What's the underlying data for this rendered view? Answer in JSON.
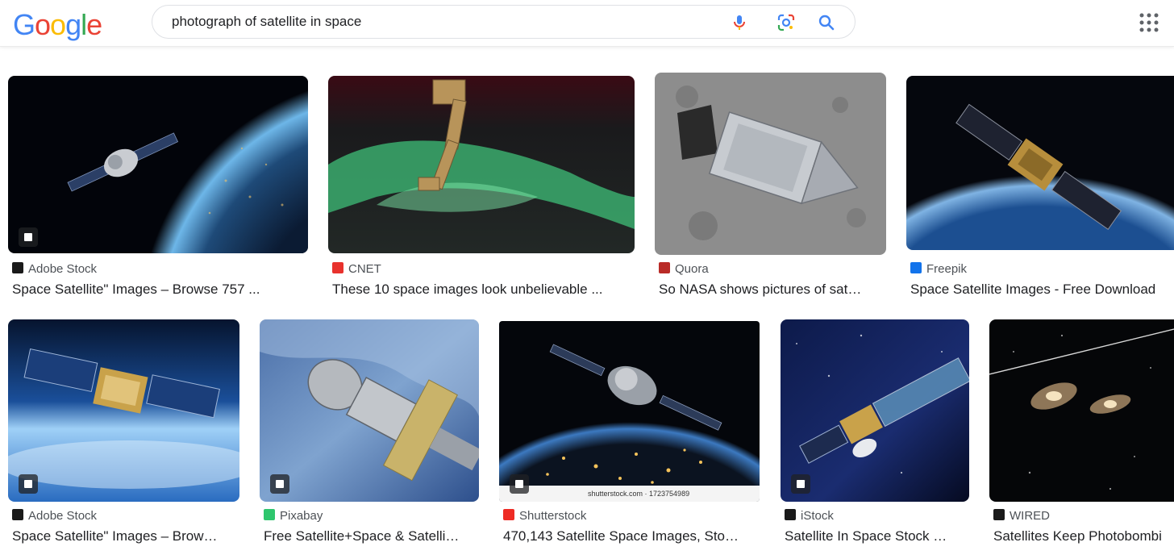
{
  "header": {
    "logo_letters": [
      "G",
      "o",
      "o",
      "g",
      "l",
      "e"
    ],
    "logo_colors": [
      "#4285F4",
      "#EA4335",
      "#FBBC05",
      "#4285F4",
      "#34A853",
      "#EA4335"
    ],
    "search_query": "photograph of satellite in space"
  },
  "results": [
    {
      "source": "Adobe Stock",
      "title": "Space Satellite\" Images – Browse 757 ...",
      "favicon": "adobe-stock-icon",
      "favicon_color": "#1a1a1a"
    },
    {
      "source": "CNET",
      "title": "These 10 space images look unbelievable ...",
      "favicon": "cnet-icon",
      "favicon_color": "#e8322d"
    },
    {
      "source": "Quora",
      "title": "So NASA shows pictures of sat…",
      "favicon": "quora-icon",
      "favicon_color": "#b92b27"
    },
    {
      "source": "Freepik",
      "title": "Space Satellite Images - Free Download",
      "favicon": "freepik-icon",
      "favicon_color": "#1273eb"
    },
    {
      "source": "Adobe Stock",
      "title": "Space Satellite\" Images – Brow…",
      "favicon": "adobe-stock-icon",
      "favicon_color": "#1a1a1a"
    },
    {
      "source": "Pixabay",
      "title": "Free Satellite+Space & Satelli…",
      "favicon": "pixabay-icon",
      "favicon_color": "#2ec66d"
    },
    {
      "source": "Shutterstock",
      "title": "470,143 Satellite Space Images, Sto…",
      "favicon": "shutterstock-icon",
      "favicon_color": "#ee2b24"
    },
    {
      "source": "iStock",
      "title": "Satellite In Space Stock …",
      "favicon": "istock-icon",
      "favicon_color": "#1a1a1a"
    },
    {
      "source": "WIRED",
      "title": "Satellites Keep Photobombi",
      "favicon": "wired-icon",
      "favicon_color": "#1a1a1a"
    }
  ],
  "watermark": "shutterstock.com · 1723754989"
}
